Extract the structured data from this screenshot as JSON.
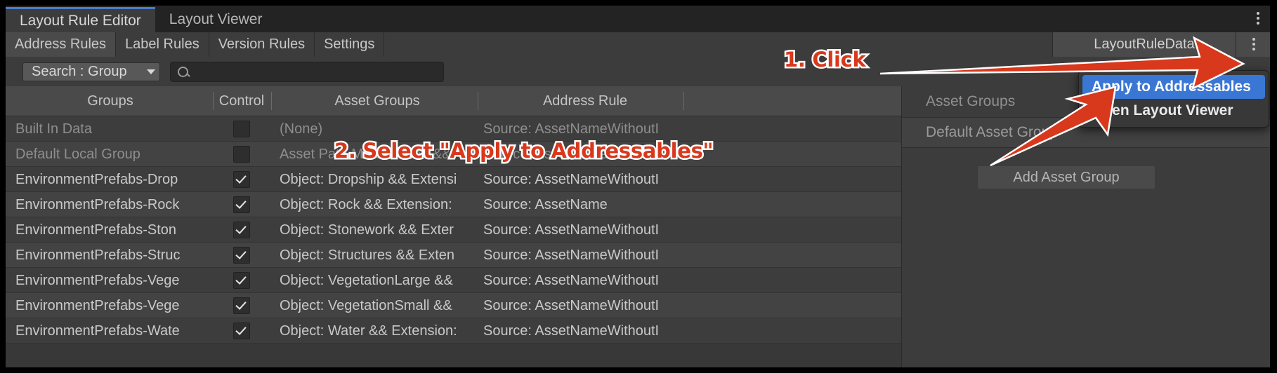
{
  "window": {
    "tabs": [
      {
        "label": "Layout Rule Editor",
        "active": true
      },
      {
        "label": "Layout Viewer",
        "active": false
      }
    ],
    "kebab_icon": "kebab-menu-icon"
  },
  "subtabs": {
    "items": [
      {
        "label": "Address Rules",
        "active": true
      },
      {
        "label": "Label Rules",
        "active": false
      },
      {
        "label": "Version Rules",
        "active": false
      },
      {
        "label": "Settings",
        "active": false
      }
    ],
    "asset_tab_label": "LayoutRuleData",
    "kebab_icon": "kebab-menu-icon"
  },
  "toolbar": {
    "search_mode_label": "Search : Group",
    "search_mode_caret_icon": "chevron-down-icon",
    "search_icon": "search-icon",
    "search_value": "",
    "search_placeholder": ""
  },
  "table": {
    "columns": [
      "Groups",
      "Control",
      "Asset Groups",
      "Address Rule"
    ],
    "rows": [
      {
        "group": "Built In Data",
        "checked": false,
        "dim": true,
        "asset_group": "(None)",
        "address_rule": "Source: AssetNameWithoutI"
      },
      {
        "group": "Default Local Group",
        "checked": false,
        "dim": true,
        "asset_group": "Asset Path Match: Ellen &&",
        "address_rule": "Source: AssetNameWithoutI"
      },
      {
        "group": "EnvironmentPrefabs-Drop",
        "checked": true,
        "dim": false,
        "asset_group": "Object: Dropship && Extensi",
        "address_rule": "Source: AssetNameWithoutI"
      },
      {
        "group": "EnvironmentPrefabs-Rock",
        "checked": true,
        "dim": false,
        "asset_group": "Object: Rock && Extension:",
        "address_rule": "Source: AssetName"
      },
      {
        "group": "EnvironmentPrefabs-Ston",
        "checked": true,
        "dim": false,
        "asset_group": "Object: Stonework && Exter",
        "address_rule": "Source: AssetNameWithoutI"
      },
      {
        "group": "EnvironmentPrefabs-Struc",
        "checked": true,
        "dim": false,
        "asset_group": "Object: Structures && Exten",
        "address_rule": "Source: AssetNameWithoutI"
      },
      {
        "group": "EnvironmentPrefabs-Vege",
        "checked": true,
        "dim": false,
        "asset_group": "Object: VegetationLarge &&",
        "address_rule": "Source: AssetNameWithoutI"
      },
      {
        "group": "EnvironmentPrefabs-Vege",
        "checked": true,
        "dim": false,
        "asset_group": "Object: VegetationSmall &&",
        "address_rule": "Source: AssetNameWithoutI"
      },
      {
        "group": "EnvironmentPrefabs-Wate",
        "checked": true,
        "dim": false,
        "asset_group": "Object: Water && Extension:",
        "address_rule": "Source: AssetNameWithoutI"
      }
    ]
  },
  "right_panel": {
    "header": "Asset Groups",
    "rows": [
      "Default Asset Group"
    ],
    "add_button_label": "Add Asset Group"
  },
  "popup": {
    "items": [
      {
        "label": "Apply to Addressables",
        "selected": true
      },
      {
        "label": "Open Layout Viewer",
        "selected": false
      }
    ]
  },
  "annotations": [
    {
      "id": "anno-click",
      "text": "1. Click"
    },
    {
      "id": "anno-select",
      "text": "2. Select \"Apply to Addressables\""
    }
  ],
  "colors": {
    "accent_blue": "#3a77d4",
    "annotation_red": "#d8381c",
    "panel_bg": "#3c3c3c",
    "active_tab_underline": "#4b7ccb"
  }
}
